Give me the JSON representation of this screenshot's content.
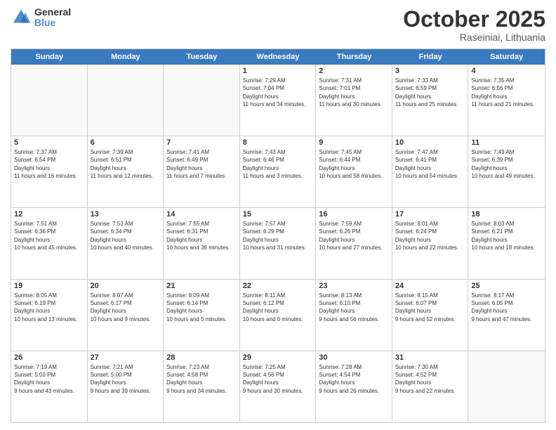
{
  "logo": {
    "general": "General",
    "blue": "Blue"
  },
  "title": "October 2025",
  "location": "Raseiniai, Lithuania",
  "days": [
    "Sunday",
    "Monday",
    "Tuesday",
    "Wednesday",
    "Thursday",
    "Friday",
    "Saturday"
  ],
  "rows": [
    [
      {
        "day": "",
        "empty": true
      },
      {
        "day": "",
        "empty": true
      },
      {
        "day": "",
        "empty": true
      },
      {
        "day": "1",
        "sunrise": "7:29 AM",
        "sunset": "7:04 PM",
        "daylight": "11 hours and 34 minutes."
      },
      {
        "day": "2",
        "sunrise": "7:31 AM",
        "sunset": "7:01 PM",
        "daylight": "11 hours and 30 minutes."
      },
      {
        "day": "3",
        "sunrise": "7:33 AM",
        "sunset": "6:59 PM",
        "daylight": "11 hours and 25 minutes."
      },
      {
        "day": "4",
        "sunrise": "7:35 AM",
        "sunset": "6:56 PM",
        "daylight": "11 hours and 21 minutes."
      }
    ],
    [
      {
        "day": "5",
        "sunrise": "7:37 AM",
        "sunset": "6:54 PM",
        "daylight": "11 hours and 16 minutes."
      },
      {
        "day": "6",
        "sunrise": "7:39 AM",
        "sunset": "6:51 PM",
        "daylight": "11 hours and 12 minutes."
      },
      {
        "day": "7",
        "sunrise": "7:41 AM",
        "sunset": "6:49 PM",
        "daylight": "11 hours and 7 minutes."
      },
      {
        "day": "8",
        "sunrise": "7:43 AM",
        "sunset": "6:46 PM",
        "daylight": "11 hours and 3 minutes."
      },
      {
        "day": "9",
        "sunrise": "7:45 AM",
        "sunset": "6:44 PM",
        "daylight": "10 hours and 58 minutes."
      },
      {
        "day": "10",
        "sunrise": "7:47 AM",
        "sunset": "6:41 PM",
        "daylight": "10 hours and 54 minutes."
      },
      {
        "day": "11",
        "sunrise": "7:49 AM",
        "sunset": "6:39 PM",
        "daylight": "10 hours and 49 minutes."
      }
    ],
    [
      {
        "day": "12",
        "sunrise": "7:51 AM",
        "sunset": "6:36 PM",
        "daylight": "10 hours and 45 minutes."
      },
      {
        "day": "13",
        "sunrise": "7:53 AM",
        "sunset": "6:34 PM",
        "daylight": "10 hours and 40 minutes."
      },
      {
        "day": "14",
        "sunrise": "7:55 AM",
        "sunset": "6:31 PM",
        "daylight": "10 hours and 36 minutes."
      },
      {
        "day": "15",
        "sunrise": "7:57 AM",
        "sunset": "6:29 PM",
        "daylight": "10 hours and 31 minutes."
      },
      {
        "day": "16",
        "sunrise": "7:59 AM",
        "sunset": "6:26 PM",
        "daylight": "10 hours and 27 minutes."
      },
      {
        "day": "17",
        "sunrise": "8:01 AM",
        "sunset": "6:24 PM",
        "daylight": "10 hours and 22 minutes."
      },
      {
        "day": "18",
        "sunrise": "8:03 AM",
        "sunset": "6:21 PM",
        "daylight": "10 hours and 18 minutes."
      }
    ],
    [
      {
        "day": "19",
        "sunrise": "8:05 AM",
        "sunset": "6:19 PM",
        "daylight": "10 hours and 13 minutes."
      },
      {
        "day": "20",
        "sunrise": "8:07 AM",
        "sunset": "6:17 PM",
        "daylight": "10 hours and 9 minutes."
      },
      {
        "day": "21",
        "sunrise": "8:09 AM",
        "sunset": "6:14 PM",
        "daylight": "10 hours and 5 minutes."
      },
      {
        "day": "22",
        "sunrise": "8:11 AM",
        "sunset": "6:12 PM",
        "daylight": "10 hours and 0 minutes."
      },
      {
        "day": "23",
        "sunrise": "8:13 AM",
        "sunset": "6:10 PM",
        "daylight": "9 hours and 56 minutes."
      },
      {
        "day": "24",
        "sunrise": "8:15 AM",
        "sunset": "6:07 PM",
        "daylight": "9 hours and 52 minutes."
      },
      {
        "day": "25",
        "sunrise": "8:17 AM",
        "sunset": "6:05 PM",
        "daylight": "9 hours and 47 minutes."
      }
    ],
    [
      {
        "day": "26",
        "sunrise": "7:19 AM",
        "sunset": "5:03 PM",
        "daylight": "9 hours and 43 minutes."
      },
      {
        "day": "27",
        "sunrise": "7:21 AM",
        "sunset": "5:00 PM",
        "daylight": "9 hours and 39 minutes."
      },
      {
        "day": "28",
        "sunrise": "7:23 AM",
        "sunset": "4:58 PM",
        "daylight": "9 hours and 34 minutes."
      },
      {
        "day": "29",
        "sunrise": "7:25 AM",
        "sunset": "4:56 PM",
        "daylight": "9 hours and 30 minutes."
      },
      {
        "day": "30",
        "sunrise": "7:28 AM",
        "sunset": "4:54 PM",
        "daylight": "9 hours and 26 minutes."
      },
      {
        "day": "31",
        "sunrise": "7:30 AM",
        "sunset": "4:52 PM",
        "daylight": "9 hours and 22 minutes."
      },
      {
        "day": "",
        "empty": true
      }
    ]
  ]
}
